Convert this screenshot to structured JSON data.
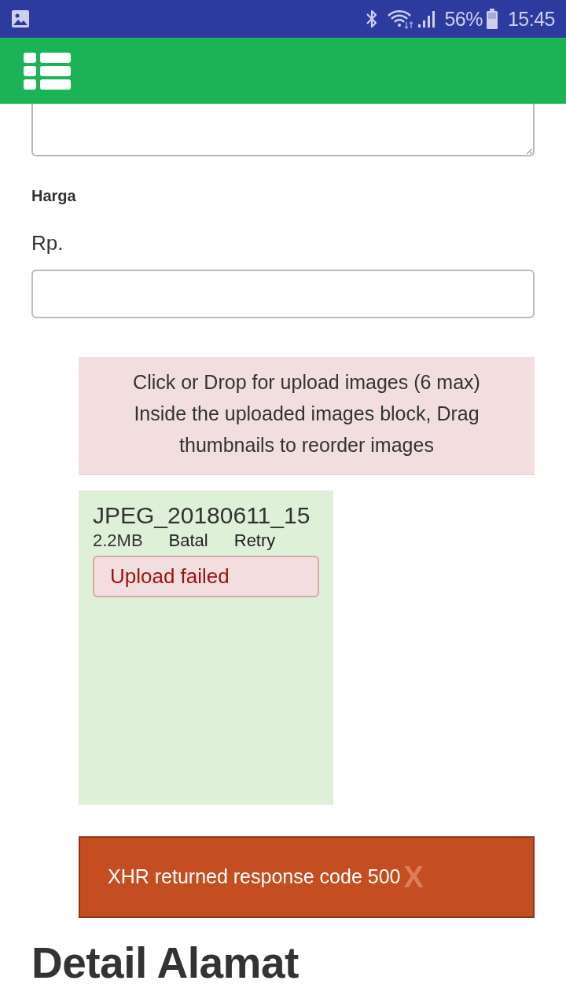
{
  "status_bar": {
    "battery": "56%",
    "time": "15:45"
  },
  "price": {
    "label": "Harga",
    "prefix": "Rp."
  },
  "dropzone": {
    "message": [
      "Click or Drop for upload images (6 max)",
      "Inside the uploaded images block, Drag thumbnails to reorder images"
    ]
  },
  "uploads": [
    {
      "filename": "JPEG_20180611_15",
      "size": "2.2MB",
      "cancel": "Batal",
      "retry": "Retry",
      "error": "Upload failed"
    }
  ],
  "alert": {
    "message": "XHR returned response code 500",
    "close": "X"
  },
  "section_heading": "Detail Alamat"
}
